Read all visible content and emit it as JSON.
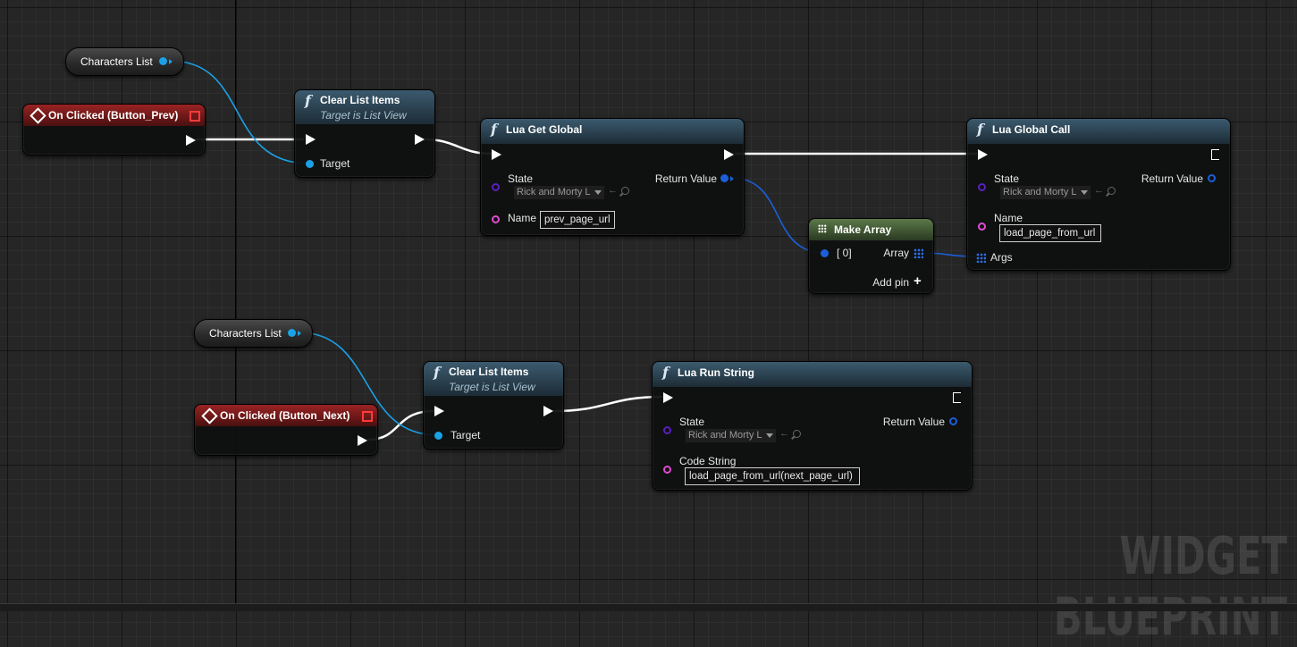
{
  "graph": {
    "watermark": "WIDGET BLUEPRINT"
  },
  "top": {
    "var_node": {
      "label": "Characters List"
    },
    "event": {
      "title": "On Clicked (Button_Prev)"
    },
    "clear_list": {
      "title": "Clear List Items",
      "subtitle": "Target is List View",
      "target_label": "Target"
    },
    "lua_get_global": {
      "title": "Lua Get Global",
      "state_label": "State",
      "state_value": "Rick and Morty L",
      "return_label": "Return Value",
      "name_label": "Name",
      "name_value": "prev_page_url"
    },
    "make_array": {
      "title": "Make Array",
      "index_label": "[ 0]",
      "array_label": "Array",
      "add_pin_label": "Add pin"
    },
    "lua_global_call": {
      "title": "Lua Global Call",
      "state_label": "State",
      "state_value": "Rick and Morty L",
      "return_label": "Return Value",
      "name_label": "Name",
      "name_value": "load_page_from_url",
      "args_label": "Args"
    }
  },
  "bottom": {
    "var_node": {
      "label": "Characters List"
    },
    "event": {
      "title": "On Clicked (Button_Next)"
    },
    "clear_list": {
      "title": "Clear List Items",
      "subtitle": "Target is List View",
      "target_label": "Target"
    },
    "lua_run_string": {
      "title": "Lua Run String",
      "state_label": "State",
      "state_value": "Rick and Morty L",
      "return_label": "Return Value",
      "code_label": "Code String",
      "code_value": "load_page_from_url(next_page_url)"
    }
  },
  "icons": {
    "function": "f-function-icon",
    "event": "diamond-event-icon",
    "delegate": "red-square-delegate-icon",
    "make_array": "grid-array-icon",
    "add_pin": "plus-icon"
  },
  "colors": {
    "exec_wire": "#ffffff",
    "object_pin": "#1aa1e6",
    "struct_pin": "#1b5fd8",
    "state_pin": "#5a1fbe",
    "string_pin": "#e14bd0",
    "event_header": "#9a2323",
    "function_header": "#3b5a6e",
    "pure_header": "#5b7848"
  }
}
